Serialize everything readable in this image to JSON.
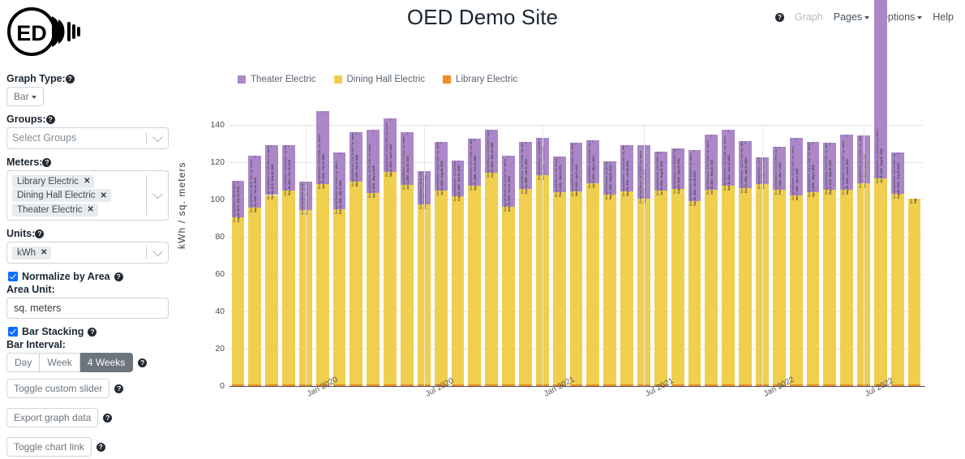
{
  "header": {
    "site_title": "OED Demo Site",
    "logo_text": "ED",
    "nav": {
      "help_icon": "help-circle-icon",
      "graph": "Graph",
      "pages": "Pages",
      "options": "Options",
      "help": "Help"
    }
  },
  "sidebar": {
    "graph_type": {
      "label": "Graph Type:",
      "value": "Bar",
      "help": "?"
    },
    "groups": {
      "label": "Groups:",
      "placeholder": "Select Groups",
      "help": "?"
    },
    "meters": {
      "label": "Meters:",
      "help": "?",
      "chips": [
        "Library Electric",
        "Dining Hall Electric",
        "Theater Electric"
      ],
      "remove_icon": "close-icon"
    },
    "units": {
      "label": "Units:",
      "help": "?",
      "chips": [
        "kWh"
      ]
    },
    "normalize": {
      "label": "Normalize by Area",
      "checked": true,
      "help": "?"
    },
    "area_unit": {
      "label": "Area Unit:",
      "value": "sq. meters"
    },
    "bar_stacking": {
      "label": "Bar Stacking",
      "checked": true,
      "help": "?"
    },
    "bar_interval": {
      "label": "Bar Interval:",
      "options": [
        "Day",
        "Week",
        "4 Weeks"
      ],
      "selected": "4 Weeks",
      "help": "?"
    },
    "toggle_slider": {
      "label": "Toggle custom slider",
      "help": "?"
    },
    "export": {
      "label": "Export graph data",
      "help": "?"
    },
    "toggle_link": {
      "label": "Toggle chart link",
      "help": "?"
    }
  },
  "chart_data": {
    "type": "bar",
    "title": "",
    "stacked": true,
    "xlabel": "",
    "ylabel": "kWh / sq. meters",
    "ylim": [
      0,
      140
    ],
    "yticks": [
      0,
      20,
      40,
      60,
      80,
      100,
      120,
      140
    ],
    "grid": true,
    "legend_position": "top-left",
    "xticks": [
      "Jan 2020",
      "Jul 2020",
      "Jan 2021",
      "Jul 2021",
      "Jan 2022",
      "Jul 2022"
    ],
    "xtick_index": [
      4,
      11,
      18,
      24,
      31,
      37
    ],
    "legend": [
      {
        "name": "Theater Electric",
        "color": "#ab87c8"
      },
      {
        "name": "Dining Hall Electric",
        "color": "#f0cf4e"
      },
      {
        "name": "Library Electric",
        "color": "#ef8d22"
      }
    ],
    "categories": [
      "Aug 26, 2019 - Sep 23, 2019",
      "Sep 23, 2019 - Oct 21, 2019",
      "Oct 21, 2019 - Nov 18, 2019",
      "Nov 18, 2019 - Dec 16, 2019",
      "Dec 16, 2019 - Jan 13, 2020",
      "Jan 13, 2020 - Feb 10, 2020",
      "Feb 10, 2020 - Mar 9, 2020",
      "Mar 9, 2020 - Apr 6, 2020",
      "Apr 6, 2020 - May 4, 2020",
      "May 4, 2020 - Jun 1, 2020",
      "Jun 1, 2020 - Jun 29, 2020",
      "Jun 29, 2020 - Jul 27, 2020",
      "Jul 27, 2020 - Aug 24, 2020",
      "Aug 24, 2020 - Sep 21, 2020",
      "Sep 21, 2020 - Oct 19, 2020",
      "Oct 19, 2020 - Nov 16, 2020",
      "Nov 16, 2020 - Dec 14, 2020",
      "Dec 14, 2020 - Jan 11, 2021",
      "Jan 11, 2021 - Feb 8, 2021",
      "Feb 8, 2021 - Mar 8, 2021",
      "Mar 8, 2021 - Apr 5, 2021",
      "Apr 5, 2021 - May 3, 2021",
      "May 3, 2021 - May 31, 2021",
      "May 31, 2021 - Jun 28, 2021",
      "Jun 28, 2021 - Jul 26, 2021",
      "Jul 26, 2021 - Aug 23, 2021",
      "Aug 23, 2021 - Sep 20, 2021",
      "Sep 20, 2021 - Oct 18, 2021",
      "Oct 18, 2021 - Nov 15, 2021",
      "Nov 15, 2021 - Dec 13, 2021",
      "Dec 13, 2021 - Jan 10, 2022",
      "Jan 10, 2022 - Feb 7, 2022",
      "Feb 7, 2022 - Mar 7, 2022",
      "Mar 7, 2022 - Apr 4, 2022",
      "Apr 4, 2022 - May 2, 2022",
      "May 2, 2022 - May 30, 2022",
      "May 30, 2022 - Jun 27, 2022",
      "Jun 27, 2022 - Jul 25, 2022",
      "Jul 25, 2022 - Aug 22, 2022",
      "Aug 22, 2022 - Sep 19, 2022",
      "Sep 19, 2022 - Oct 17, 2022"
    ],
    "series": [
      {
        "name": "Library Electric",
        "color": "#ef8d22",
        "values": [
          0.9,
          0.9,
          0.9,
          0.9,
          0.9,
          0.9,
          0.9,
          0.9,
          0.9,
          0.9,
          0.9,
          0.9,
          0.9,
          0.9,
          0.9,
          0.9,
          0.9,
          0.9,
          0.9,
          0.9,
          0.9,
          0.9,
          0.9,
          0.9,
          0.9,
          0.9,
          0.9,
          0.9,
          0.9,
          0.9,
          0.9,
          0.9,
          0.9,
          0.9,
          0.9,
          0.9,
          0.9,
          0.9,
          0.9,
          0.9,
          0.9
        ]
      },
      {
        "name": "Dining Hall Electric",
        "color": "#f0cf4e",
        "values": [
          89.4,
          94.8,
          101.5,
          103.7,
          93.5,
          107.2,
          93.7,
          108.7,
          102.7,
          113.9,
          107.1,
          96.4,
          104.1,
          100.9,
          106.7,
          113.4,
          95.1,
          104.7,
          112.3,
          102.9,
          103.5,
          107.6,
          101.8,
          103.4,
          99.7,
          104.1,
          104.8,
          98.4,
          104.2,
          106.3,
          105.2,
          107.3,
          104.5,
          101.3,
          103.1,
          104.4,
          104.3,
          107.6,
          110.2,
          102.0,
          99.5
        ]
      },
      {
        "name": "Theater Electric",
        "color": "#ab87c8",
        "values": [
          19.9,
          27.7,
          26.6,
          24.6,
          15.0,
          39.5,
          30.7,
          26.3,
          33.9,
          28.9,
          27.9,
          17.8,
          26.0,
          19.0,
          25.2,
          23.1,
          27.4,
          25.1,
          19.9,
          19.3,
          26.0,
          23.2,
          17.6,
          25.0,
          28.4,
          20.6,
          21.5,
          27.3,
          29.5,
          30.4,
          25.1,
          14.2,
          22.7,
          30.8,
          26.9,
          25.3,
          29.6,
          26.0,
          111.0,
          22.4
        ]
      }
    ],
    "bar_labels": [
      "Aug 26, 2019 - Sep 23, 2019\nDining Hall Electric: 89.38 kWh / sq. meters",
      "Sep 23, 2019 - Oct 21, 2019\nDining Hall Electric: 94.82 kWh / sq. meters",
      "Oct 21, 2019 - Nov 18, 2019\nDining Hall Electric: 101.53 kWh / sq. meters",
      "Nov 18, 2019 - Dec 16, 2019\nDining Hall Electric: 103.66 kWh / sq. meters",
      "Dec 16, 2019 - Jan 13, 2020\nDining Hall Electric: 93.52 kWh / sq. meters",
      "Jan 13, 2020 - Feb 10, 2020\nDining Hall Electric: 107.18 kWh / sq. meters",
      "Feb 10, 2020 - Mar 9, 2020\nDining Hall Electric: 93.74 kWh / sq. meters",
      "Mar 9, 2020 - Apr 6, 2020\nDining Hall Electric: 108.74 kWh / sq. meters",
      "Apr 6, 2020 - May 4, 2020\nDining Hall Electric: 102.71 kWh / sq. meters",
      "May 4, 2020 - Jun 1, 2020\nDining Hall Electric: 113.91 kWh / sq. meters",
      "Jun 1, 2020 - Jun 29, 2020\nDining Hall Electric: 107.10 kWh / sq. meters",
      "Jun 29, 2020 - Jul 27, 2020\nDining Hall Electric: 96.41 kWh / sq. meters",
      "Jul 27, 2020 - Aug 24, 2020\nDining Hall Electric: 104.07 kWh / sq. meters",
      "Aug 24, 2020 - Sep 21, 2020\nDining Hall Electric: 100.93 kWh / sq. meters",
      "Sep 21, 2020 - Oct 19, 2020\nDining Hall Electric: 106.70 kWh / sq. meters",
      "Oct 19, 2020 - Nov 16, 2020\nDining Hall Electric: 113.42 kWh / sq. meters",
      "Nov 16, 2020 - Dec 14, 2020\nDining Hall Electric: 95.13 kWh / sq. meters",
      "Dec 14, 2020 - Jan 11, 2021\nDining Hall Electric: 104.74 kWh / sq. meters",
      "Jan 11, 2021 - Feb 8, 2021\nDining Hall Electric: 112.33 kWh / sq. meters",
      "Feb 8, 2021 - Mar 8, 2021\nDining Hall Electric: 102.94 kWh / sq. meters",
      "Mar 8, 2021 - Apr 5, 2021\nDining Hall Electric: 103.54 kWh / sq. meters",
      "Apr 5, 2021 - May 3, 2021\nDining Hall Electric: 107.63 kWh / sq. meters",
      "May 3, 2021 - May 31, 2021\nDining Hall Electric: 101.85 kWh / sq. meters",
      "May 31, 2021 - Jun 28, 2021\nDining Hall Electric: 103.44 kWh / sq. meters",
      "Jun 28, 2021 - Jul 26, 2021\nDining Hall Electric: 99.73 kWh / sq. meters",
      "Jul 26, 2021 - Aug 23, 2021\nDining Hall Electric: 104.15 kWh / sq. meters",
      "Aug 23, 2021 - Sep 20, 2021\nDining Hall Electric: 104.83 kWh / sq. meters",
      "Sep 20, 2021 - Oct 18, 2021\nDining Hall Electric: 98.44 kWh / sq. meters",
      "Oct 18, 2021 - Nov 15, 2021\nDining Hall Electric: 104.19 kWh / sq. meters",
      "Nov 15, 2021 - Dec 13, 2021\nDining Hall Electric: 106.30 kWh / sq. meters",
      "Dec 13, 2021 - Jan 10, 2022\nDining Hall Electric: 105.20 kWh / sq. meters",
      "Jan 10, 2022 - Feb 7, 2022\nDining Hall Electric: 107.30 kWh / sq. meters",
      "Feb 7, 2022 - Mar 7, 2022\nDining Hall Electric: 104.50 kWh / sq. meters",
      "Mar 7, 2022 - Apr 4, 2022\nDining Hall Electric: 101.30 kWh / sq. meters",
      "Apr 4, 2022 - May 2, 2022\nDining Hall Electric: 103.10 kWh / sq. meters",
      "May 2, 2022 - May 30, 2022\nDining Hall Electric: 104.40 kWh / sq. meters",
      "May 30, 2022 - Jun 27, 2022\nDining Hall Electric: 104.30 kWh / sq. meters",
      "Jun 27, 2022 - Jul 25, 2022\nDining Hall Electric: 107.60 kWh / sq. meters",
      "Jul 25, 2022 - Aug 22, 2022\nDining Hall Electric: 110.20 kWh / sq. meters",
      "Aug 22, 2022 - Sep 19, 2022\nDining Hall Electric: 102.00 kWh / sq. meters",
      "Sep 19, 2022 - Oct 17, 2022\nDining Hall Electric: 99.50 kWh / sq. meters"
    ]
  }
}
